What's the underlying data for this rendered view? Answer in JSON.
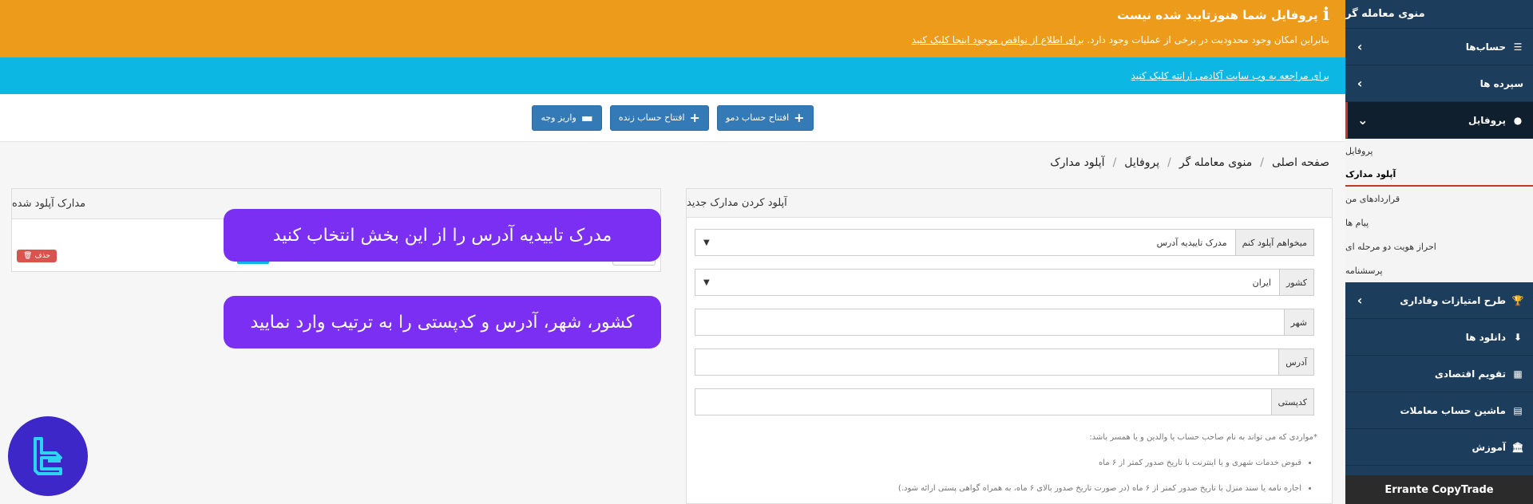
{
  "warning": {
    "title": "پروفایل شما هنوزتایید شده نیست",
    "text": "بنابراین امکان وجود محدودیت در برخی از عملیات وجود دارد.",
    "link": "برای اطلاع از نواقص موجود اینجا کلیک کنید"
  },
  "info": {
    "link": "برای مراجعه به وب سایت آکادمی ارانته کلیک کنید"
  },
  "actions": {
    "demo": "افتتاح حساب دمو",
    "live": "افتتاح حساب زنده",
    "deposit": "واریز وجه"
  },
  "breadcrumb": [
    "صفحه اصلی",
    "منوی معامله گر",
    "پروفایل",
    "آپلود مدارک"
  ],
  "upload_panel": {
    "title": "آپلود کردن مدارک جدید",
    "fields": [
      {
        "label": "میخواهم آپلود کنم",
        "value": "مدرک تاییدیه آدرس",
        "select": true
      },
      {
        "label": "کشور",
        "value": "ایران",
        "select": true
      },
      {
        "label": "شهر",
        "value": ""
      },
      {
        "label": "آدرس",
        "value": ""
      },
      {
        "label": "کدپستی",
        "value": ""
      }
    ],
    "notes_title": "*مواردی که می تواند به نام صاحب حساب یا والدین و یا همسر باشد:",
    "notes": [
      "قبوض خدمات شهری و یا اینترنت با تاریخ صدور کمتر از ۶ ماه",
      "اجاره نامه یا سند منزل با تاریخ صدور کمتر از ۶ ماه (در صورت تاریخ صدور بالای ۶ ماه، به همراه گواهی پستی ارائه شود.)"
    ]
  },
  "uploaded_panel": {
    "title": "مدارک آپلود شده",
    "delete": "حذف"
  },
  "callouts": {
    "c1": "مدرک تاییدیه آدرس را از این بخش انتخاب کنید",
    "c2": "کشور، شهر، آدرس و کدپستی را به ترتیب وارد نمایید"
  },
  "sidebar": {
    "header": "منوی معامله گر",
    "items": [
      {
        "label": "حساب‌ها",
        "icon": "list-icon",
        "chevron": "‹"
      },
      {
        "label": "سپرده ها",
        "icon": "none",
        "chevron": "‹"
      },
      {
        "label": "پروفایل",
        "icon": "user-icon",
        "chevron": "⌄",
        "active": true
      }
    ],
    "subitems": [
      "پروفایل",
      "آپلود مدارک",
      "قراردادهای من",
      "پیام ها",
      "احراز هویت دو مرحله ای",
      "پرسشنامه"
    ],
    "items2": [
      {
        "label": "طرح امتیازات وفاداری",
        "icon": "trophy-icon",
        "chevron": "‹"
      },
      {
        "label": "دانلود ها",
        "icon": "download-icon"
      },
      {
        "label": "تقویم اقتصادی",
        "icon": "calendar-icon"
      },
      {
        "label": "ماشین حساب معاملات",
        "icon": "calculator-icon"
      },
      {
        "label": "آموزش",
        "icon": "bank-icon"
      }
    ],
    "footer": "Errante CopyTrade"
  },
  "colors": {
    "warning": "#ec9b1a",
    "info": "#0cb7e3",
    "sidebar": "#1d3d5c",
    "callout": "#7b2ff2",
    "button": "#337ab7"
  }
}
